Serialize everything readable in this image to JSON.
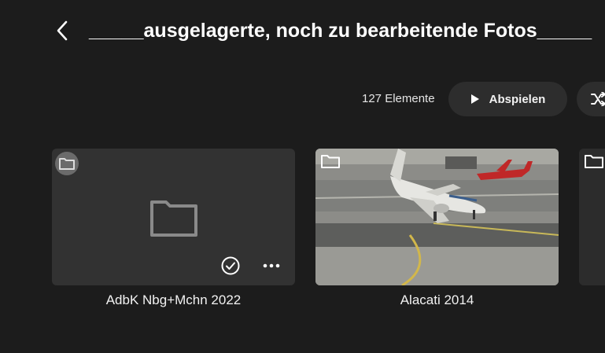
{
  "header": {
    "title": "_____ausgelagerte, noch zu bearbeitende Fotos_____",
    "back_icon": "chevron-left-icon"
  },
  "toolbar": {
    "item_count": "127 Elemente",
    "play_label": "Abspielen",
    "play_icon": "play-icon",
    "shuffle_icon": "shuffle-icon"
  },
  "items": [
    {
      "name": "AdbK Nbg+Mchn 2022",
      "type": "folder",
      "selected_icon": "check-circle-icon",
      "more_icon": "more-icon"
    },
    {
      "name": "Alacati 2014",
      "type": "folder"
    },
    {
      "name": "",
      "type": "folder"
    }
  ],
  "colors": {
    "background": "#1c1c1c",
    "button_bg": "#2d2d2d",
    "card_bg": "#323232",
    "text": "#ffffff"
  }
}
